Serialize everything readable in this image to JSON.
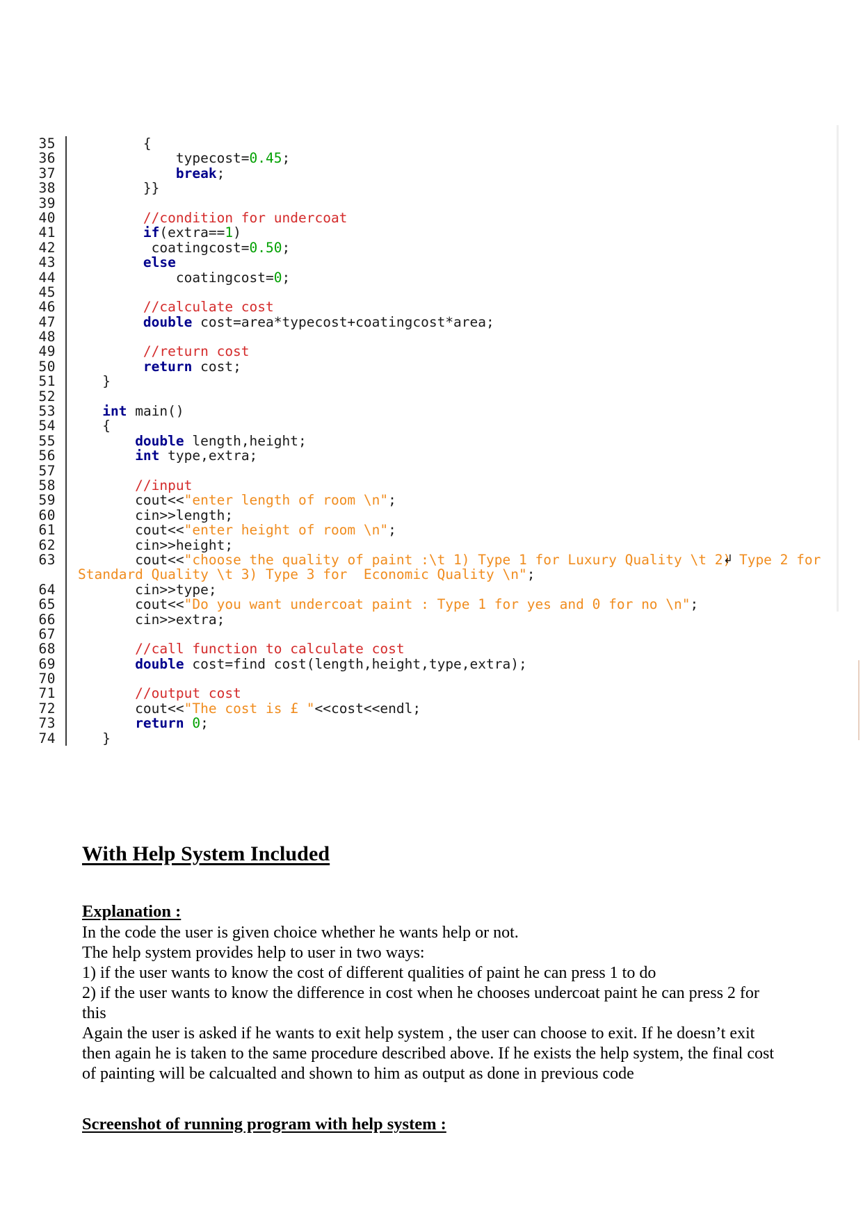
{
  "document": {
    "code_listing": {
      "first_line_number": 35,
      "last_line_number": 74,
      "wrap_marker_glyph": "↲",
      "colors": {
        "keyword": "#00008c",
        "comment": "#d42b2b",
        "string": "#f08c1e",
        "number": "#00a000",
        "plain": "#1a1a1a",
        "gutter": "#1a1a1a"
      },
      "lines": [
        {
          "n": 35,
          "segments": [
            {
              "t": "        {",
              "c": "pln"
            }
          ]
        },
        {
          "n": 36,
          "segments": [
            {
              "t": "            typecost=",
              "c": "pln"
            },
            {
              "t": "0.45",
              "c": "num"
            },
            {
              "t": ";",
              "c": "pln"
            }
          ]
        },
        {
          "n": 37,
          "segments": [
            {
              "t": "            ",
              "c": "pln"
            },
            {
              "t": "break",
              "c": "kw"
            },
            {
              "t": ";",
              "c": "pln"
            }
          ]
        },
        {
          "n": 38,
          "segments": [
            {
              "t": "        }}",
              "c": "pln"
            }
          ]
        },
        {
          "n": 39,
          "segments": [
            {
              "t": "",
              "c": "pln"
            }
          ]
        },
        {
          "n": 40,
          "segments": [
            {
              "t": "        //condition for undercoat",
              "c": "cmt"
            }
          ]
        },
        {
          "n": 41,
          "segments": [
            {
              "t": "        ",
              "c": "pln"
            },
            {
              "t": "if",
              "c": "kw"
            },
            {
              "t": "(extra==",
              "c": "pln"
            },
            {
              "t": "1",
              "c": "num"
            },
            {
              "t": ")",
              "c": "pln"
            }
          ]
        },
        {
          "n": 42,
          "segments": [
            {
              "t": "         coatingcost=",
              "c": "pln"
            },
            {
              "t": "0.50",
              "c": "num"
            },
            {
              "t": ";",
              "c": "pln"
            }
          ]
        },
        {
          "n": 43,
          "segments": [
            {
              "t": "        ",
              "c": "pln"
            },
            {
              "t": "else",
              "c": "kw"
            }
          ]
        },
        {
          "n": 44,
          "segments": [
            {
              "t": "            coatingcost=",
              "c": "pln"
            },
            {
              "t": "0",
              "c": "num"
            },
            {
              "t": ";",
              "c": "pln"
            }
          ]
        },
        {
          "n": 45,
          "segments": [
            {
              "t": "",
              "c": "pln"
            }
          ]
        },
        {
          "n": 46,
          "segments": [
            {
              "t": "        //calculate cost",
              "c": "cmt"
            }
          ]
        },
        {
          "n": 47,
          "segments": [
            {
              "t": "        ",
              "c": "pln"
            },
            {
              "t": "double",
              "c": "kw"
            },
            {
              "t": " cost=area*typecost+coatingcost*area;",
              "c": "pln"
            }
          ]
        },
        {
          "n": 48,
          "segments": [
            {
              "t": "",
              "c": "pln"
            }
          ]
        },
        {
          "n": 49,
          "segments": [
            {
              "t": "        //return cost",
              "c": "cmt"
            }
          ]
        },
        {
          "n": 50,
          "segments": [
            {
              "t": "        ",
              "c": "pln"
            },
            {
              "t": "return",
              "c": "kw"
            },
            {
              "t": " cost;",
              "c": "pln"
            }
          ]
        },
        {
          "n": 51,
          "segments": [
            {
              "t": "   }",
              "c": "pln"
            }
          ]
        },
        {
          "n": 52,
          "segments": [
            {
              "t": "",
              "c": "pln"
            }
          ]
        },
        {
          "n": 53,
          "segments": [
            {
              "t": "   ",
              "c": "pln"
            },
            {
              "t": "int",
              "c": "kw"
            },
            {
              "t": " main()",
              "c": "pln"
            }
          ]
        },
        {
          "n": 54,
          "segments": [
            {
              "t": "   {",
              "c": "pln"
            }
          ]
        },
        {
          "n": 55,
          "segments": [
            {
              "t": "       ",
              "c": "pln"
            },
            {
              "t": "double",
              "c": "kw"
            },
            {
              "t": " length,height;",
              "c": "pln"
            }
          ]
        },
        {
          "n": 56,
          "segments": [
            {
              "t": "       ",
              "c": "pln"
            },
            {
              "t": "int",
              "c": "kw"
            },
            {
              "t": " type,extra;",
              "c": "pln"
            }
          ]
        },
        {
          "n": 57,
          "segments": [
            {
              "t": "",
              "c": "pln"
            }
          ]
        },
        {
          "n": 58,
          "segments": [
            {
              "t": "       //input",
              "c": "cmt"
            }
          ]
        },
        {
          "n": 59,
          "segments": [
            {
              "t": "       cout<<",
              "c": "pln"
            },
            {
              "t": "\"enter length of room \\n\"",
              "c": "str"
            },
            {
              "t": ";",
              "c": "pln"
            }
          ]
        },
        {
          "n": 60,
          "segments": [
            {
              "t": "       cin>>length;",
              "c": "pln"
            }
          ]
        },
        {
          "n": 61,
          "segments": [
            {
              "t": "       cout<<",
              "c": "pln"
            },
            {
              "t": "\"enter height of room \\n\"",
              "c": "str"
            },
            {
              "t": ";",
              "c": "pln"
            }
          ]
        },
        {
          "n": 62,
          "segments": [
            {
              "t": "       cin>>height;",
              "c": "pln"
            }
          ]
        },
        {
          "n": 63,
          "wrapped": true,
          "segments": [
            {
              "t": "       cout<<",
              "c": "pln"
            },
            {
              "t": "\"choose the quality of paint :\\t 1) Type 1 for Luxury Quality \\t 2) Type 2 for Standard Quality \\t 3) Type 3 for  Economic Quality \\n\"",
              "c": "str"
            },
            {
              "t": ";",
              "c": "pln"
            }
          ]
        },
        {
          "n": 64,
          "segments": [
            {
              "t": "       cin>>type;",
              "c": "pln"
            }
          ]
        },
        {
          "n": 65,
          "segments": [
            {
              "t": "       cout<<",
              "c": "pln"
            },
            {
              "t": "\"Do you want undercoat paint : Type 1 for yes and 0 for no \\n\"",
              "c": "str"
            },
            {
              "t": ";",
              "c": "pln"
            }
          ]
        },
        {
          "n": 66,
          "segments": [
            {
              "t": "       cin>>extra;",
              "c": "pln"
            }
          ]
        },
        {
          "n": 67,
          "segments": [
            {
              "t": "",
              "c": "pln"
            }
          ]
        },
        {
          "n": 68,
          "segments": [
            {
              "t": "       //call function to calculate cost",
              "c": "cmt"
            }
          ]
        },
        {
          "n": 69,
          "segments": [
            {
              "t": "       ",
              "c": "pln"
            },
            {
              "t": "double",
              "c": "kw"
            },
            {
              "t": " cost=find cost(length,height,type,extra);",
              "c": "pln"
            }
          ]
        },
        {
          "n": 70,
          "segments": [
            {
              "t": "",
              "c": "pln"
            }
          ]
        },
        {
          "n": 71,
          "segments": [
            {
              "t": "       //output cost",
              "c": "cmt"
            }
          ]
        },
        {
          "n": 72,
          "segments": [
            {
              "t": "       cout<<",
              "c": "pln"
            },
            {
              "t": "\"The cost is £ \"",
              "c": "str"
            },
            {
              "t": "<<cost<<endl;",
              "c": "pln"
            }
          ]
        },
        {
          "n": 73,
          "segments": [
            {
              "t": "       ",
              "c": "pln"
            },
            {
              "t": "return",
              "c": "kw"
            },
            {
              "t": " ",
              "c": "pln"
            },
            {
              "t": "0",
              "c": "num"
            },
            {
              "t": ";",
              "c": "pln"
            }
          ]
        },
        {
          "n": 74,
          "segments": [
            {
              "t": "   }",
              "c": "pln"
            }
          ]
        }
      ]
    },
    "prose": {
      "title": "With Help System Included ",
      "explanation_heading": "Explanation :",
      "explanation_lines": [
        "In the code the user is given choice whether he wants help or not.",
        "The help system provides help to user in two ways:",
        "1) if the user wants to know the cost of different qualities of paint he can press 1 to do",
        "2) if the user wants to know the difference in cost when he chooses undercoat paint he can press 2 for this"
      ],
      "closing_paragraph": "Again the user is asked if he wants to exit help system , the user can choose to exit. If he doesn’t exit then again he is taken to the same procedure described above. If he exists the help system, the final cost of painting will be calcualted and shown to him as output as done in previous code",
      "footer_heading": "Screenshot of running program with help system :"
    }
  }
}
